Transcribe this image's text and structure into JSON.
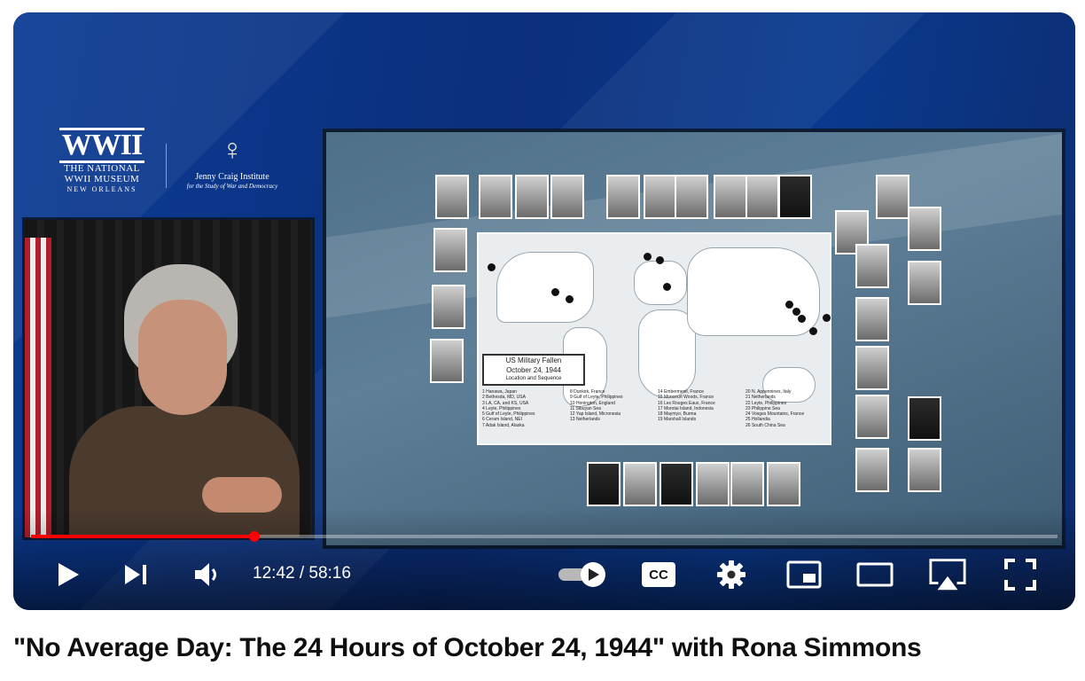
{
  "player": {
    "current_time": "12:42",
    "duration": "58:16",
    "time_separator": " / ",
    "progress_fraction": 0.218,
    "accent_color": "#ff0000"
  },
  "logos": {
    "wwii_mark": "WWII",
    "wwii_line1": "THE NATIONAL",
    "wwii_line2": "WWII MUSEUM",
    "wwii_line3": "NEW ORLEANS",
    "jc_name": "Jenny Craig Institute",
    "jc_sub": "for the Study of War and Democracy"
  },
  "slide": {
    "box_title": "US Military Fallen",
    "box_date": "October 24, 1944",
    "box_sub": "Location and Sequence",
    "legend": [
      [
        "1 Hanawa, Japan",
        "2 Bethesda, MD, USA",
        "3 LA, CA, and KS, USA",
        "4 Leyte, Philippines",
        "5 Gulf of Leyte, Philippines",
        "6 Ceram Island, NEI",
        "7 Adak Island, Alaska"
      ],
      [
        "8 Dunkirk, France",
        "9 Gulf of Leyte, Philippines",
        "10 Honington, England",
        "11 Sibuyan Sea",
        "12 Yap Island, Micronesia",
        "13 Netherlands"
      ],
      [
        "14 Embermenil, France",
        "15 Moncourt Woods, France",
        "16 Les Rouges Eaux, France",
        "17 Morotai Island, Indonesia",
        "18 Maymyo, Burma",
        "19 Marshall Islands"
      ],
      [
        "20 N. Appennines, Italy",
        "21 Netherlands",
        "22 Leyte, Philippines",
        "23 Philippine Sea",
        "24 Vosges Mountains, France",
        "25 Hollandia",
        "26 South China Sea"
      ]
    ]
  },
  "icons": {
    "play": "play-icon",
    "next": "next-icon",
    "volume": "volume-icon",
    "autoplay": "autoplay-toggle-icon",
    "cc": "captions-icon",
    "settings": "gear-icon",
    "miniplayer": "miniplayer-icon",
    "theater": "theater-mode-icon",
    "airplay": "airplay-icon",
    "fullscreen": "fullscreen-icon"
  },
  "labels": {
    "cc_text": "CC"
  },
  "video_title": "\"No Average Day: The 24 Hours of October 24, 1944\" with Rona Simmons"
}
